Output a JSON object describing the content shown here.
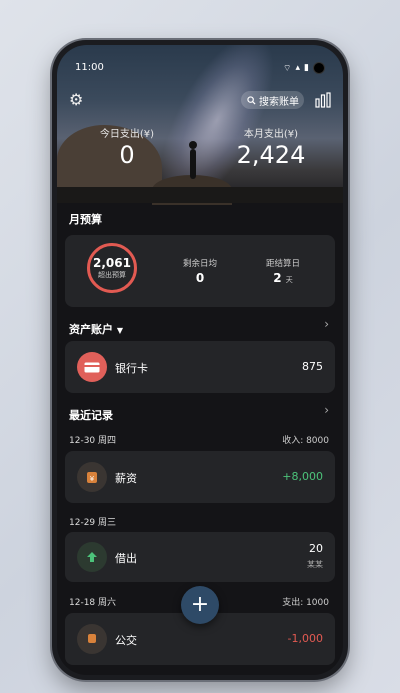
{
  "status_bar": {
    "time": "11:00"
  },
  "header": {
    "search_label": "搜索账单",
    "today_label": "今日支出(¥)",
    "today_value": "0",
    "month_label": "本月支出(¥)",
    "month_value": "2,424"
  },
  "budget": {
    "section_title": "月预算",
    "ring_value": "2,061",
    "ring_sub": "超出预算",
    "daily_label": "剩余日均",
    "daily_value": "0",
    "settle_label": "距结算日",
    "settle_value": "2",
    "settle_unit": "天"
  },
  "assets": {
    "section_title": "资产账户",
    "account_label": "银行卡",
    "account_value": "875"
  },
  "recent": {
    "section_title": "最近记录",
    "groups": [
      {
        "date": "12-30 周四",
        "summary": "收入: 8000",
        "item_label": "薪资",
        "item_value": "+8,000"
      },
      {
        "date": "12-29 周三",
        "summary": "",
        "item_label": "借出",
        "item_value": "20",
        "item_sub": "某某"
      },
      {
        "date": "12-18 周六",
        "summary": "支出: 1000",
        "item_label": "公交",
        "item_value": "-1,000"
      }
    ]
  },
  "fab_label": "+",
  "colors": {
    "accent_red": "#e25a52",
    "income_green": "#4cc37a",
    "fab": "#2e4a67"
  }
}
